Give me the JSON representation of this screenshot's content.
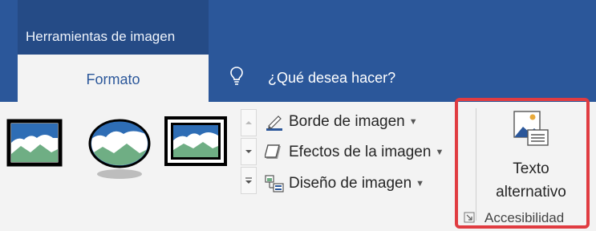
{
  "header": {
    "context_group_label": "Herramientas de imagen",
    "active_tab": "Formato",
    "search_label": "¿Qué desea hacer?"
  },
  "picture_styles": {
    "commands": [
      {
        "label": "Borde de imagen",
        "icon": "pen-border-icon"
      },
      {
        "label": "Efectos de la imagen",
        "icon": "effects-icon"
      },
      {
        "label": "Diseño de imagen",
        "icon": "layout-icon"
      }
    ]
  },
  "accessibility": {
    "button_line1": "Texto",
    "button_line2": "alternativo",
    "group_label": "Accesibilidad"
  },
  "colors": {
    "ribbon_blue": "#2b579a",
    "context_blue": "#254b86",
    "highlight_red": "#e03c41"
  }
}
